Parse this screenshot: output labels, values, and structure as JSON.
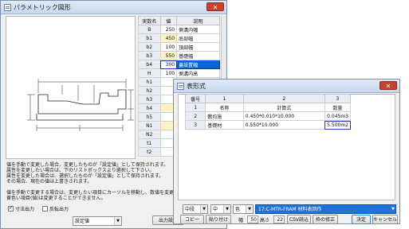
{
  "param_window": {
    "title": "パラメトリック図形",
    "close_label": "✕",
    "table": {
      "headers": [
        "実数名",
        "値",
        "説明"
      ],
      "rows": [
        {
          "key": "B",
          "value": "250",
          "desc": "側溝内幅",
          "state": ""
        },
        {
          "key": "b1",
          "value": "450",
          "desc": "底部幅",
          "state": "hl"
        },
        {
          "key": "b2",
          "value": "100",
          "desc": "頂部幅",
          "state": ""
        },
        {
          "key": "b3",
          "value": "550",
          "desc": "基礎幅",
          "state": "hl"
        },
        {
          "key": "b4",
          "value": "300",
          "desc": "蓋設置幅",
          "state": "sel"
        },
        {
          "key": "H",
          "value": "100",
          "desc": "側溝内高",
          "state": ""
        },
        {
          "key": "h1",
          "value": "",
          "desc": "",
          "state": ""
        },
        {
          "key": "h2",
          "value": "",
          "desc": "",
          "state": ""
        },
        {
          "key": "h3",
          "value": "",
          "desc": "",
          "state": ""
        },
        {
          "key": "h4",
          "value": "",
          "desc": "",
          "state": "hl"
        },
        {
          "key": "h5",
          "value": "",
          "desc": "",
          "state": ""
        },
        {
          "key": "N1",
          "value": "",
          "desc": "",
          "state": "hl"
        },
        {
          "key": "N2",
          "value": "",
          "desc": "",
          "state": ""
        },
        {
          "key": "t1",
          "value": "",
          "desc": "",
          "state": ""
        },
        {
          "key": "t2",
          "value": "",
          "desc": "",
          "state": ""
        }
      ]
    },
    "notes": [
      "値を手動で変更した場合、変更したものが「設定値」として保持されます。",
      "属性を変更したい場合は、下のリストボックスより選択して下さい。",
      "属性を変更した場合は、選択したものが「設定値」として保持されます。",
      "その場合、現在の値は上書きされます。",
      "",
      "値を手動で変更する場合は、変更したい項目にカーソルを移動し、数値を変更して下さい。",
      "黄色い項目(値)は変更することができません。"
    ],
    "check_dimension": "寸法出力",
    "check_mirror": "反転出力",
    "setting_value": "設定値",
    "output_button": "出力設定"
  },
  "table_window": {
    "title": "表形式",
    "close_label": "✕",
    "col_headers": [
      "番号",
      "1",
      "2",
      "3"
    ],
    "rows": [
      {
        "num": "1",
        "c1": "名称",
        "c2": "計算式",
        "c3": "数量"
      },
      {
        "num": "2",
        "c1": "敷均施",
        "c2": "0.450*0.010*10.000",
        "c3": "0.045m3"
      },
      {
        "num": "3",
        "c1": "基礎材",
        "c2": "0.550*10.000",
        "c3": "5.500m2"
      }
    ],
    "toolbar": {
      "combo_align_v": "中段",
      "combo_align_h": "中",
      "combo_color": "色",
      "path": "17:C-MTR-FRAM  材料表回作",
      "copy": "コピー",
      "paste": "貼り付け",
      "width_label": "幅",
      "width_value": "50",
      "height_label": "高さ",
      "height_value": "22",
      "csv": "CSV読込",
      "fix_frame": "枠の修正",
      "ok": "決定",
      "cancel": "キャンセル"
    }
  }
}
